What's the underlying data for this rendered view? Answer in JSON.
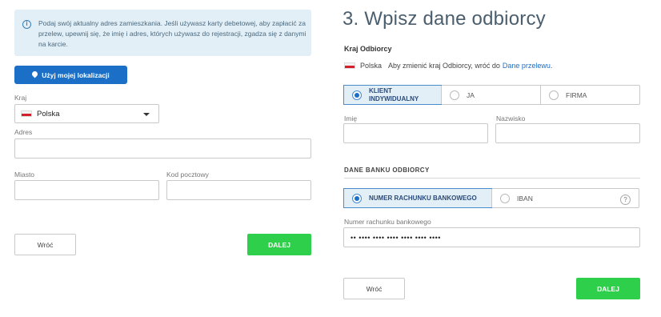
{
  "left": {
    "info_text": "Podaj swój aktualny adres zamieszkania. Jeśli używasz karty debetowej, aby zapłacić za przelew, upewnij się, że imię i adres, których używasz do rejestracji, zgadza się z danymi na karcie.",
    "location_button": "Użyj mojej lokalizacji",
    "country_label": "Kraj",
    "country_value": "Polska",
    "address_label": "Adres",
    "address_value": "",
    "city_label": "Miasto",
    "city_value": "",
    "postal_label": "Kod pocztowy",
    "postal_value": "",
    "back_button": "Wróć",
    "next_button": "DALEJ"
  },
  "right": {
    "title": "3. Wpisz dane odbiorcy",
    "recipient_country_heading": "Kraj Odbiorcy",
    "recipient_country": "Polska",
    "change_country_text": "Aby zmienić kraj Odbiorcy, wróć do",
    "change_country_link": "Dane przelewu.",
    "recipient_types": [
      {
        "label": "KLIENT INDYWIDUALNY",
        "selected": true
      },
      {
        "label": "JA",
        "selected": false
      },
      {
        "label": "FIRMA",
        "selected": false
      }
    ],
    "first_name_label": "Imię",
    "first_name_value": "",
    "last_name_label": "Nazwisko",
    "last_name_value": "",
    "bank_section_heading": "DANE BANKU ODBIORCY",
    "account_types": [
      {
        "label": "NUMER RACHUNKU BANKOWEGO",
        "selected": true
      },
      {
        "label": "IBAN",
        "selected": false
      }
    ],
    "help_icon": "?",
    "account_number_label": "Numer rachunku bankowego",
    "account_number_value": "•• •••• •••• •••• •••• •••• ••••",
    "back_button": "Wróć",
    "next_button": "DALEJ"
  },
  "colors": {
    "primary_blue": "#1b6fc6",
    "next_green": "#2ed04b",
    "info_bg": "#e3eff6"
  }
}
